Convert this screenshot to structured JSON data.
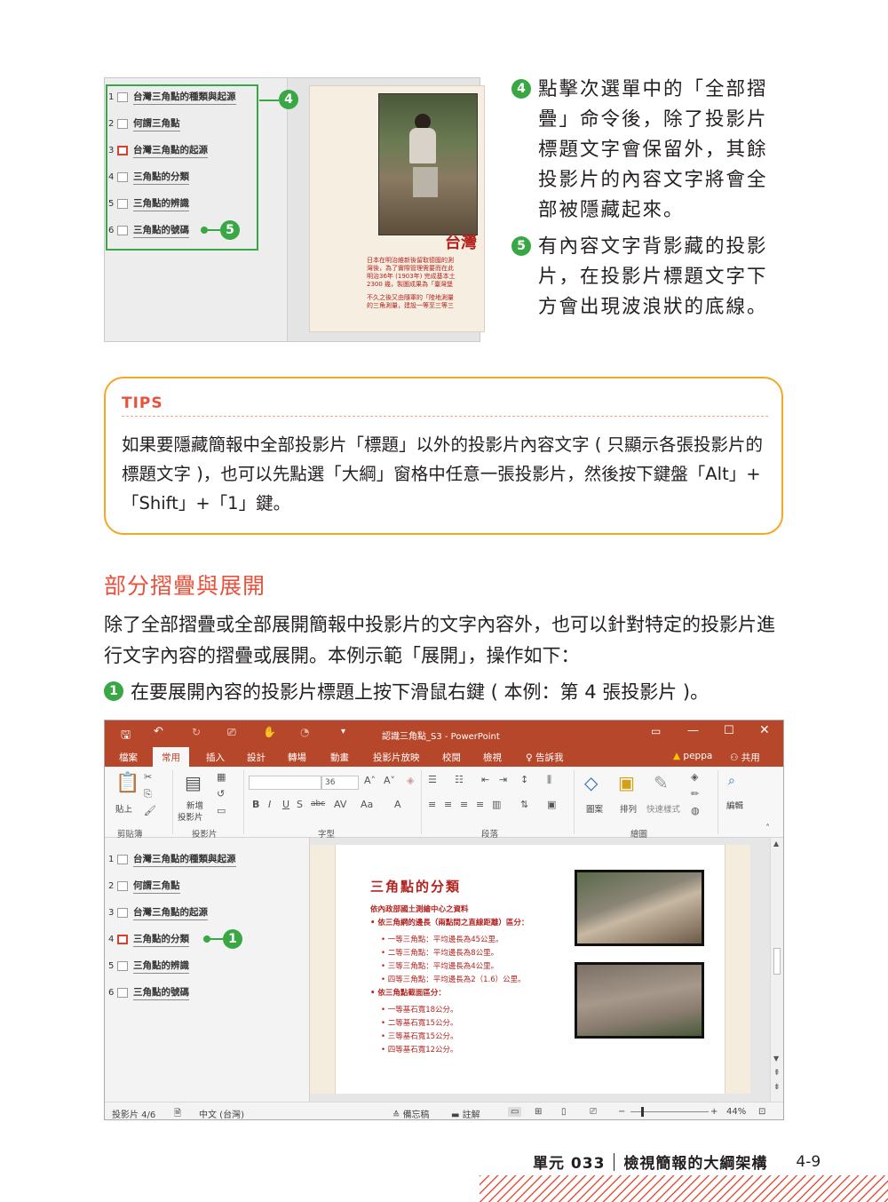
{
  "figure1": {
    "outline_items": [
      {
        "num": "1",
        "text": "台灣三角點的種類與起源"
      },
      {
        "num": "2",
        "text": "何謂三角點"
      },
      {
        "num": "3",
        "text": "台灣三角點的起源"
      },
      {
        "num": "4",
        "text": "三角點的分類"
      },
      {
        "num": "5",
        "text": "三角點的辨識"
      },
      {
        "num": "6",
        "text": "三角點的號碼"
      }
    ],
    "callouts": [
      "4",
      "5"
    ],
    "slide_title": "台灣",
    "slide_text_lines": [
      "日本在明治維新後留取德國的測",
      "灣後，為了實際管理需要而在此",
      "明治36年 (1903年) 完成基本土",
      "2300 幾，製圖成果為「臺灣堡",
      "",
      "不久之後又由隨軍的「陸地測量",
      "的三角測量，建設一等至三等三"
    ]
  },
  "steps_right": [
    {
      "num": "4",
      "text": "點擊次選單中的「全部摺疊」命令後，除了投影片標題文字會保留外，其餘投影片的內容文字將會全部被隱藏起來。"
    },
    {
      "num": "5",
      "text": "有內容文字背影藏的投影片，在投影片標題文字下方會出現波浪狀的底線。"
    }
  ],
  "tips": {
    "title": "TIPS",
    "body": "如果要隱藏簡報中全部投影片「標題」以外的投影片內容文字 ( 只顯示各張投影片的標題文字 )，也可以先點選「大綱」窗格中任意一張投影片，然後按下鍵盤「Alt」+「Shift」+「1」鍵。"
  },
  "section": {
    "title": "部分摺疊與展開",
    "paragraph": "除了全部摺疊或全部展開簡報中投影片的文字內容外，也可以針對特定的投影片進行文字內容的摺疊或展開。本例示範「展開」，操作如下：",
    "step_num": "1",
    "step_text": "在要展開內容的投影片標題上按下滑鼠右鍵 ( 本例：第 4 張投影片 )。"
  },
  "ppt": {
    "window_title": "認識三角點_S3 - PowerPoint",
    "tabs": [
      "檔案",
      "常用",
      "插入",
      "設計",
      "轉場",
      "動畫",
      "投影片放映",
      "校閱",
      "檢視",
      "告訴我"
    ],
    "active_tab": "常用",
    "user": "peppa",
    "share": "共用",
    "ribbon": {
      "paste": "貼上",
      "new_slide_1": "新增",
      "new_slide_2": "投影片",
      "font_size": "36",
      "shapes": "圖案",
      "arrange": "排列",
      "quick_styles": "快速樣式",
      "editing": "編輯",
      "groups": [
        "剪貼簿",
        "投影片",
        "字型",
        "段落",
        "繪圖"
      ]
    },
    "outline_items": [
      {
        "num": "1",
        "text": "台灣三角點的種類與起源"
      },
      {
        "num": "2",
        "text": "何謂三角點"
      },
      {
        "num": "3",
        "text": "台灣三角點的起源"
      },
      {
        "num": "4",
        "text": "三角點的分類"
      },
      {
        "num": "5",
        "text": "三角點的辨識"
      },
      {
        "num": "6",
        "text": "三角點的號碼"
      }
    ],
    "callout": "1",
    "slide": {
      "title": "三角點的分類",
      "lines": [
        {
          "text": "依內政部國土測繪中心之資料",
          "bold": true,
          "indent": 0
        },
        {
          "text": "• 依三角網的邊長（兩點間之直線距離）區分：",
          "bold": true,
          "indent": 0
        },
        {
          "text": "• 一等三角點：平均邊長為45公里。",
          "bold": false,
          "indent": 1
        },
        {
          "text": "• 二等三角點：平均邊長為8公里。",
          "bold": false,
          "indent": 1
        },
        {
          "text": "• 三等三角點：平均邊長為4公里。",
          "bold": false,
          "indent": 1
        },
        {
          "text": "• 四等三角點：平均邊長為2（1.6）公里。",
          "bold": false,
          "indent": 1
        },
        {
          "text": "• 依三角點截面區分：",
          "bold": true,
          "indent": 0
        },
        {
          "text": "• 一等基石寬18公分。",
          "bold": false,
          "indent": 1
        },
        {
          "text": "• 二等基石寬15公分。",
          "bold": false,
          "indent": 1
        },
        {
          "text": "• 三等基石寬15公分。",
          "bold": false,
          "indent": 1
        },
        {
          "text": "• 四等基石寬12公分。",
          "bold": false,
          "indent": 1
        }
      ]
    },
    "status": {
      "slide_count": "投影片 4/6",
      "language": "中文 (台灣)",
      "notes": "備忘稿",
      "comments": "註解",
      "zoom": "44%"
    }
  },
  "footer": {
    "unit": "單元 033",
    "title": "檢視簡報的大綱架構",
    "page": "4-9"
  },
  "colors": {
    "accent_green": "#3aa745",
    "accent_orange": "#f5a623",
    "accent_red": "#e9513c",
    "ppt_brand": "#b7472a"
  }
}
